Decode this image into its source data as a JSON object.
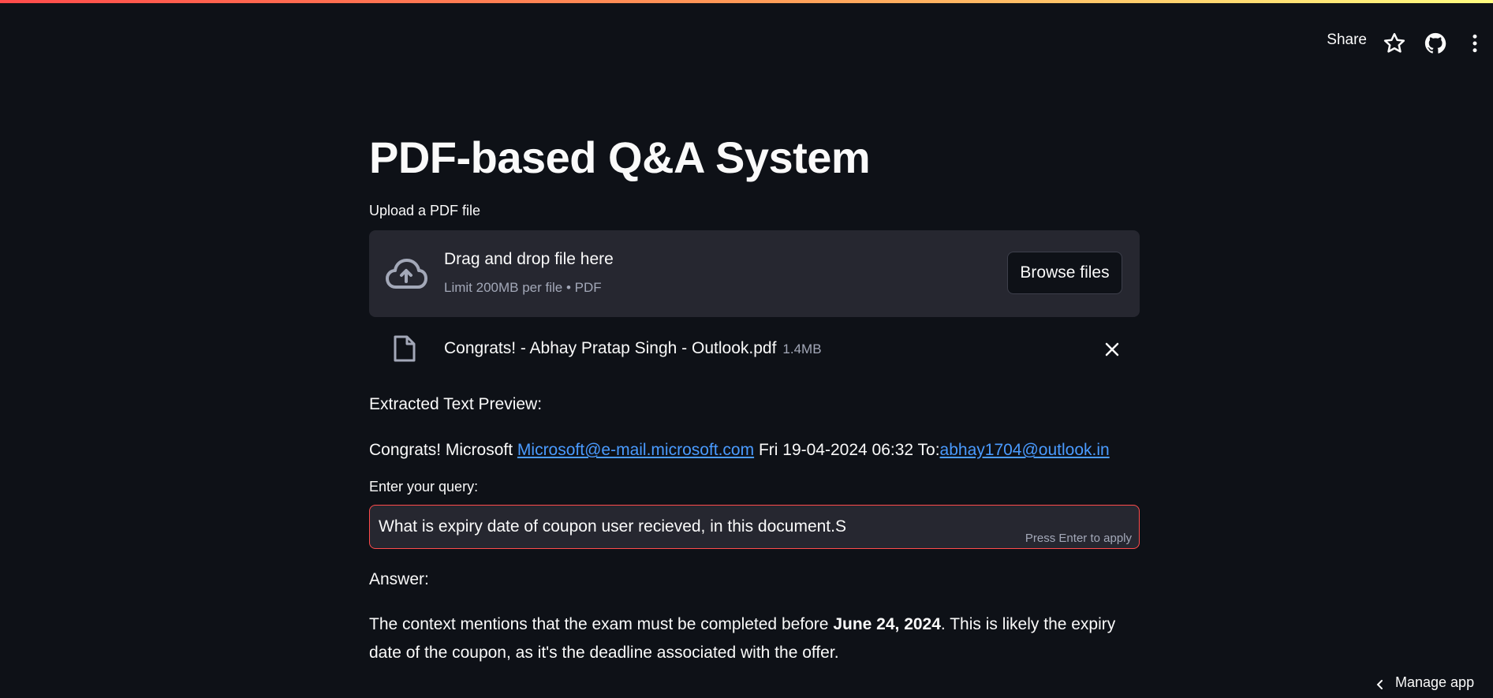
{
  "header": {
    "share_label": "Share"
  },
  "icons": {
    "star": "star-icon",
    "github": "github-icon",
    "menu": "more-vertical-icon",
    "cloud": "cloud-upload-icon",
    "file": "file-icon",
    "close": "close-icon",
    "chevron": "chevron-left-icon"
  },
  "colors": {
    "background": "#0e1117",
    "panel": "#262730",
    "accent": "#ff4b4b",
    "link": "#4a9bff"
  },
  "main": {
    "title": "PDF-based Q&A System",
    "upload_label": "Upload a PDF file",
    "dropzone": {
      "title": "Drag and drop file here",
      "subtitle": "Limit 200MB per file • PDF",
      "browse_label": "Browse files"
    },
    "file": {
      "name": "Congrats! - Abhay Pratap Singh - Outlook.pdf",
      "size": "1.4MB"
    },
    "preview_label": "Extracted Text Preview:",
    "preview": {
      "prefix": "Congrats! Microsoft ",
      "link1": "Microsoft@e-mail.microsoft.com",
      "middle": " Fri 19-04-2024 06:32 To:",
      "link2": "abhay1704@outlook.in"
    },
    "query_label": "Enter your query:",
    "query_value": "What is expiry date of coupon user recieved, in this document.S",
    "press_enter": "Press Enter to apply",
    "answer_label": "Answer:",
    "answer": {
      "part1": "The context mentions that the exam must be completed before ",
      "bold": "June 24, 2024",
      "part2": ". This is likely the expiry date of the coupon, as it's the deadline associated with the offer."
    }
  },
  "footer": {
    "manage_app": "Manage app"
  }
}
